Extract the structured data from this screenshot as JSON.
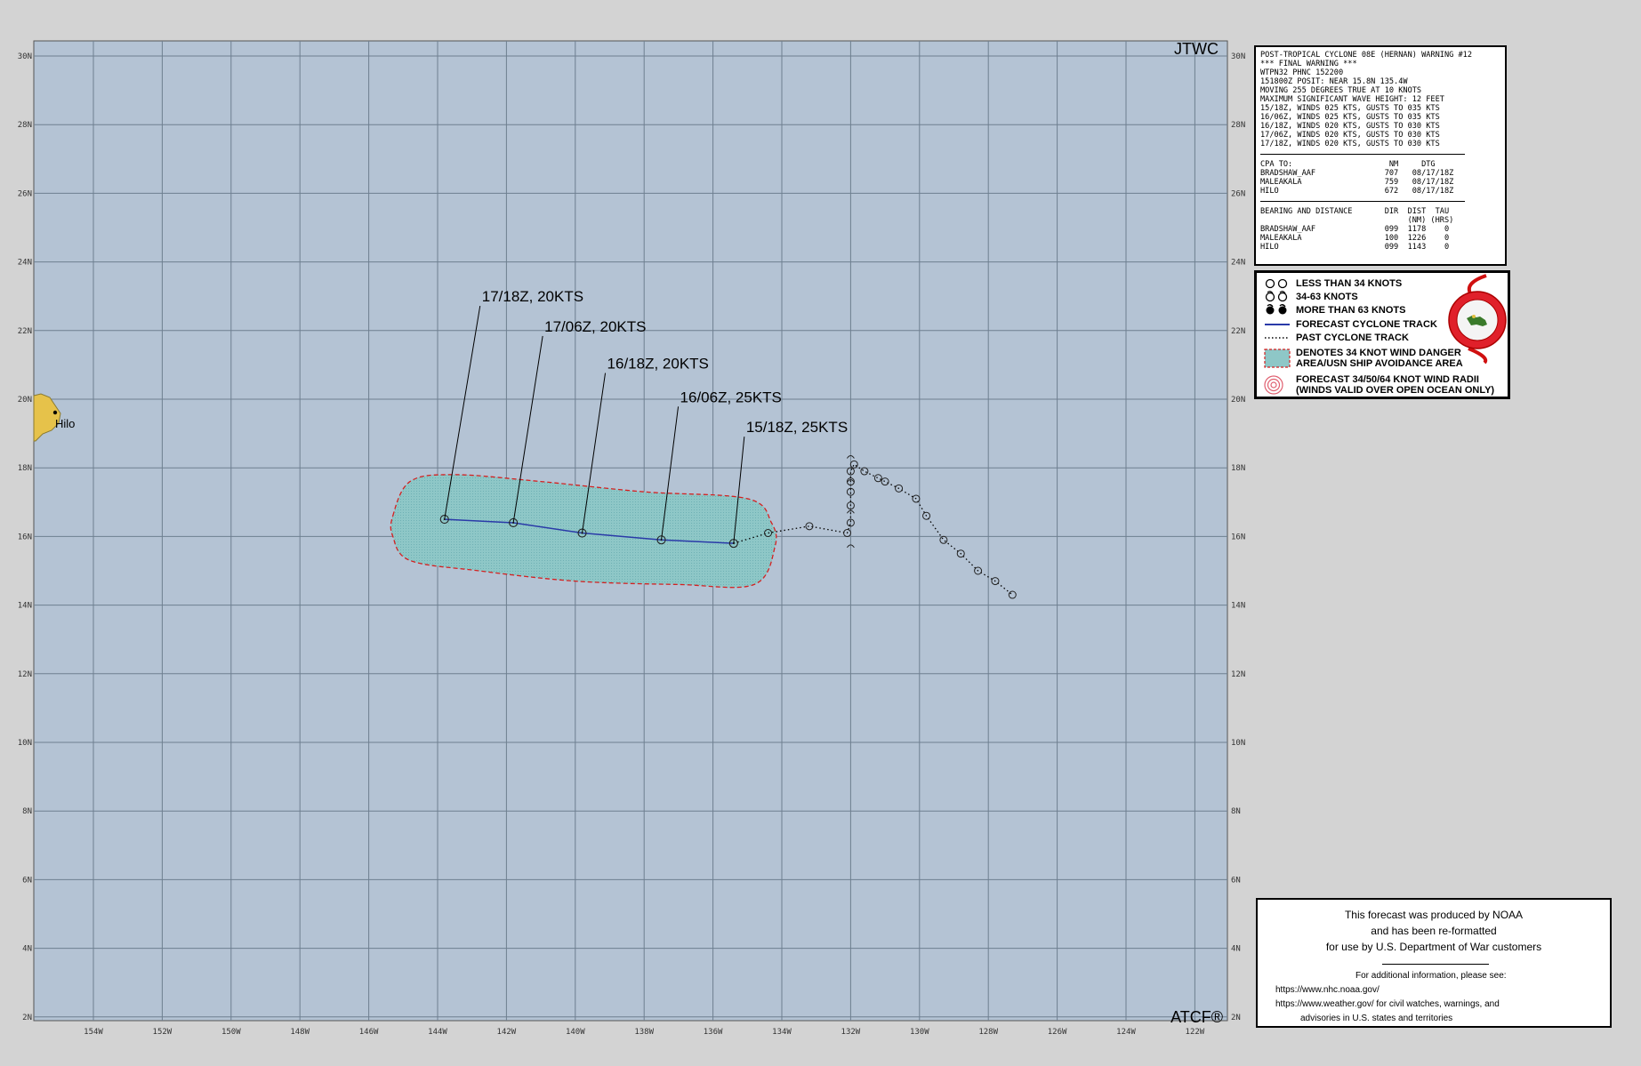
{
  "map": {
    "header_label": "JTWC",
    "footer_label": "ATCF®",
    "lat_ticks": [
      "30N",
      "28N",
      "26N",
      "24N",
      "22N",
      "20N",
      "18N",
      "16N",
      "14N",
      "12N",
      "10N",
      "8N",
      "6N",
      "4N",
      "2N"
    ],
    "lon_ticks": [
      "154W",
      "152W",
      "150W",
      "148W",
      "146W",
      "144W",
      "142W",
      "140W",
      "138W",
      "136W",
      "134W",
      "132W",
      "130W",
      "128W",
      "126W",
      "124W",
      "122W"
    ],
    "place_label": "Hilo",
    "colors": {
      "ocean": "#b4c3d4",
      "grid": "#6e7f90",
      "land": "#e6c24a",
      "forecast_track": "#2a3aa8",
      "danger_area": "#8ec7c7",
      "danger_border": "#d42020"
    }
  },
  "forecast_track": [
    {
      "label": "15/18Z, 25KTS",
      "lon": -135.4,
      "lat": 15.8
    },
    {
      "label": "16/06Z, 25KTS",
      "lon": -137.5,
      "lat": 15.9
    },
    {
      "label": "16/18Z, 20KTS",
      "lon": -139.8,
      "lat": 16.1
    },
    {
      "label": "17/06Z, 20KTS",
      "lon": -141.8,
      "lat": 16.4
    },
    {
      "label": "17/18Z, 20KTS",
      "lon": -143.8,
      "lat": 16.5
    }
  ],
  "past_track": [
    [
      -134.4,
      16.1
    ],
    [
      -133.2,
      16.3
    ],
    [
      -132.1,
      16.1
    ],
    [
      -132.0,
      16.4
    ],
    [
      -132.0,
      16.9
    ],
    [
      -132.0,
      17.3
    ],
    [
      -132.0,
      17.6
    ],
    [
      -132.0,
      17.9
    ],
    [
      -131.9,
      18.1
    ],
    [
      -131.6,
      17.9
    ],
    [
      -131.2,
      17.7
    ],
    [
      -131.0,
      17.6
    ],
    [
      -130.6,
      17.4
    ],
    [
      -130.1,
      17.1
    ],
    [
      -129.8,
      16.6
    ],
    [
      -129.3,
      15.9
    ],
    [
      -128.8,
      15.5
    ],
    [
      -128.3,
      15.0
    ],
    [
      -127.8,
      14.7
    ],
    [
      -127.3,
      14.3
    ]
  ],
  "past_spiral_markers": [
    [
      -132.0,
      15.6
    ],
    [
      -132.0,
      16.6
    ],
    [
      -132.0,
      17.5
    ],
    [
      -132.0,
      18.2
    ]
  ],
  "danger_area": [
    [
      -145.3,
      16.6
    ],
    [
      -144.8,
      17.6
    ],
    [
      -143.5,
      17.8
    ],
    [
      -141.0,
      17.6
    ],
    [
      -138.0,
      17.3
    ],
    [
      -135.0,
      17.1
    ],
    [
      -134.3,
      16.4
    ],
    [
      -134.2,
      15.7
    ],
    [
      -134.8,
      14.6
    ],
    [
      -137.0,
      14.6
    ],
    [
      -140.0,
      14.7
    ],
    [
      -142.8,
      15.0
    ],
    [
      -144.8,
      15.3
    ],
    [
      -145.3,
      16.0
    ]
  ],
  "warning": {
    "lines": [
      "POST-TROPICAL CYCLONE 08E (HERNAN) WARNING #12",
      "*** FINAL WARNING ***",
      "WTPN32 PHNC 152200",
      "151800Z POSIT: NEAR 15.8N 135.4W",
      "MOVING 255 DEGREES TRUE AT 10 KNOTS",
      "MAXIMUM SIGNIFICANT WAVE HEIGHT: 12 FEET",
      "15/18Z, WINDS 025 KTS, GUSTS TO 035 KTS",
      "16/06Z, WINDS 025 KTS, GUSTS TO 035 KTS",
      "16/18Z, WINDS 020 KTS, GUSTS TO 030 KTS",
      "17/06Z, WINDS 020 KTS, GUSTS TO 030 KTS",
      "17/18Z, WINDS 020 KTS, GUSTS TO 030 KTS"
    ],
    "cpa_header": "CPA TO:                     NM     DTG",
    "cpa_rows": [
      "BRADSHAW_AAF               707   08/17/18Z",
      "MALEAKALA                  759   08/17/18Z",
      "HILO                       672   08/17/18Z"
    ],
    "bearing_header": "BEARING AND DISTANCE       DIR  DIST  TAU",
    "bearing_sub": "                                (NM) (HRS)",
    "bearing_rows": [
      "BRADSHAW_AAF               099  1178    0",
      "MALEAKALA                  100  1226    0",
      "HILO                       099  1143    0"
    ]
  },
  "legend": {
    "items": [
      "LESS THAN 34 KNOTS",
      "34-63 KNOTS",
      "MORE THAN 63 KNOTS",
      "FORECAST CYCLONE TRACK",
      "PAST CYCLONE TRACK",
      "DENOTES 34 KNOT WIND DANGER",
      "AREA/USN SHIP AVOIDANCE AREA",
      "FORECAST 34/50/64 KNOT WIND RADII",
      "(WINDS VALID OVER OPEN OCEAN ONLY)"
    ]
  },
  "noaa": {
    "line1": "This forecast was produced by NOAA",
    "line2": "and has been re-formatted",
    "line3": "for use by U.S. Department of War customers",
    "info_title": "For additional information, please see:",
    "url1": "https://www.nhc.noaa.gov/",
    "url2": "https://www.weather.gov/ for civil watches, warnings, and",
    "url2_cont": "advisories in U.S. states and territories"
  }
}
